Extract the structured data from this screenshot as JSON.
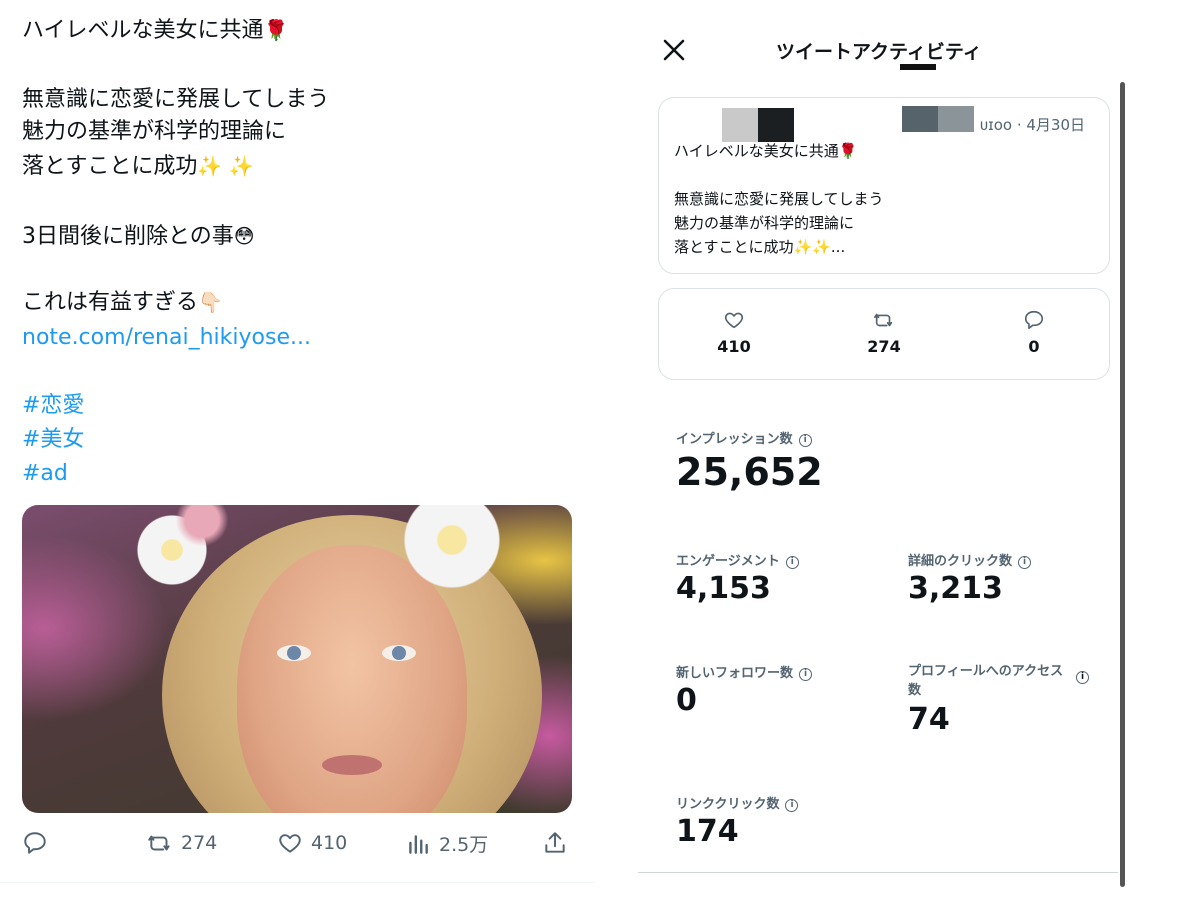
{
  "tweet": {
    "line1": "ハイレベルな美女に共通",
    "rose": "🌹",
    "line2": "無意識に恋愛に発展してしまう",
    "line3": "魅力の基準が科学的理論に",
    "line4": "落とすことに成功",
    "sparkles": "✨ ✨",
    "line5": "3日間後に削除との事",
    "flushed": "😳",
    "line6": "これは有益すぎる",
    "point": "👇🏻",
    "link": "note.com/renai_hikiyose...",
    "tags": [
      "#恋愛",
      "#美女",
      "#ad"
    ],
    "actions": {
      "retweets": "274",
      "likes": "410",
      "views": "2.5万"
    }
  },
  "activity": {
    "title": "ツイートアクティビティ",
    "preview": {
      "handle_fragment": "ᴜɪoo · 4月30日",
      "line1": "ハイレベルな美女に共通🌹",
      "line2": "無意識に恋愛に発展してしまう",
      "line3": "魅力の基準が科学的理論に",
      "line4": "落とすことに成功✨✨..."
    },
    "stats": {
      "likes": "410",
      "retweets": "274",
      "replies": "0"
    },
    "metrics": {
      "impressions_label": "インプレッション数",
      "impressions": "25,652",
      "engagement_label": "エンゲージメント",
      "engagement": "4,153",
      "detail_clicks_label": "詳細のクリック数",
      "detail_clicks": "3,213",
      "new_followers_label": "新しいフォロワー数",
      "new_followers": "0",
      "profile_visits_label": "プロフィールへのアクセス数",
      "profile_visits": "74",
      "link_clicks_label": "リンククリック数",
      "link_clicks": "174"
    }
  },
  "colors": {
    "link": "#1d9bf0",
    "text": "#0f1419",
    "muted": "#536471",
    "border": "#dbe2e6"
  }
}
